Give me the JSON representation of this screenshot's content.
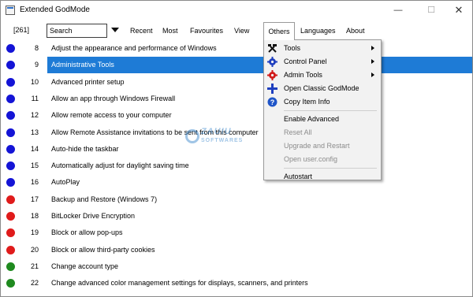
{
  "window": {
    "title": "Extended GodMode",
    "minimize": "—",
    "maximize": "☐",
    "close": "✕"
  },
  "toolbar": {
    "count": "[261]",
    "search_placeholder": "Search",
    "menu": {
      "recent": "Recent",
      "most": "Most",
      "favourites": "Favourites",
      "view": "View",
      "others": "Others",
      "languages": "Languages",
      "about": "About"
    }
  },
  "colors": {
    "blue_dot": "#1414d6",
    "red_dot": "#e01b1b",
    "green_dot": "#1f8a1f",
    "selection": "#1e7bd6"
  },
  "list": [
    {
      "num": "8",
      "text": "Adjust the appearance and performance of Windows",
      "dot": "blue"
    },
    {
      "num": "9",
      "text": "Administrative Tools",
      "dot": "blue",
      "selected": true
    },
    {
      "num": "10",
      "text": "Advanced printer setup",
      "dot": "blue"
    },
    {
      "num": "11",
      "text": "Allow an app through Windows Firewall",
      "dot": "blue"
    },
    {
      "num": "12",
      "text": "Allow remote access to your computer",
      "dot": "blue"
    },
    {
      "num": "13",
      "text": "Allow Remote Assistance invitations to be sent from this computer",
      "dot": "blue"
    },
    {
      "num": "14",
      "text": "Auto-hide the taskbar",
      "dot": "blue"
    },
    {
      "num": "15",
      "text": "Automatically adjust for daylight saving time",
      "dot": "blue"
    },
    {
      "num": "16",
      "text": "AutoPlay",
      "dot": "blue"
    },
    {
      "num": "17",
      "text": "Backup and Restore (Windows 7)",
      "dot": "red"
    },
    {
      "num": "18",
      "text": "BitLocker Drive Encryption",
      "dot": "red"
    },
    {
      "num": "19",
      "text": "Block or allow pop-ups",
      "dot": "red"
    },
    {
      "num": "20",
      "text": "Block or allow third-party cookies",
      "dot": "red"
    },
    {
      "num": "21",
      "text": "Change account type",
      "dot": "green"
    },
    {
      "num": "22",
      "text": "Change advanced color management settings for displays, scanners, and printers",
      "dot": "green"
    }
  ],
  "others_menu": {
    "group1": [
      {
        "label": "Tools",
        "icon": "tools-icon",
        "submenu": true
      },
      {
        "label": "Control Panel",
        "icon": "gear-icon",
        "submenu": true
      },
      {
        "label": "Admin Tools",
        "icon": "admin-gear-icon",
        "submenu": true
      },
      {
        "label": "Open Classic GodMode",
        "icon": "plus-icon",
        "submenu": false
      },
      {
        "label": "Copy Item Info",
        "icon": "question-icon",
        "submenu": false
      }
    ],
    "group2": [
      {
        "label": "Enable Advanced",
        "disabled": false
      },
      {
        "label": "Reset All",
        "disabled": true
      },
      {
        "label": "Upgrade and Restart",
        "disabled": true
      },
      {
        "label": "Open user.config",
        "disabled": true
      }
    ],
    "group3": [
      {
        "label": "Autostart",
        "disabled": false
      }
    ]
  },
  "watermark": {
    "line1": "ZAUIU",
    "line2": "SOFTWARES"
  }
}
